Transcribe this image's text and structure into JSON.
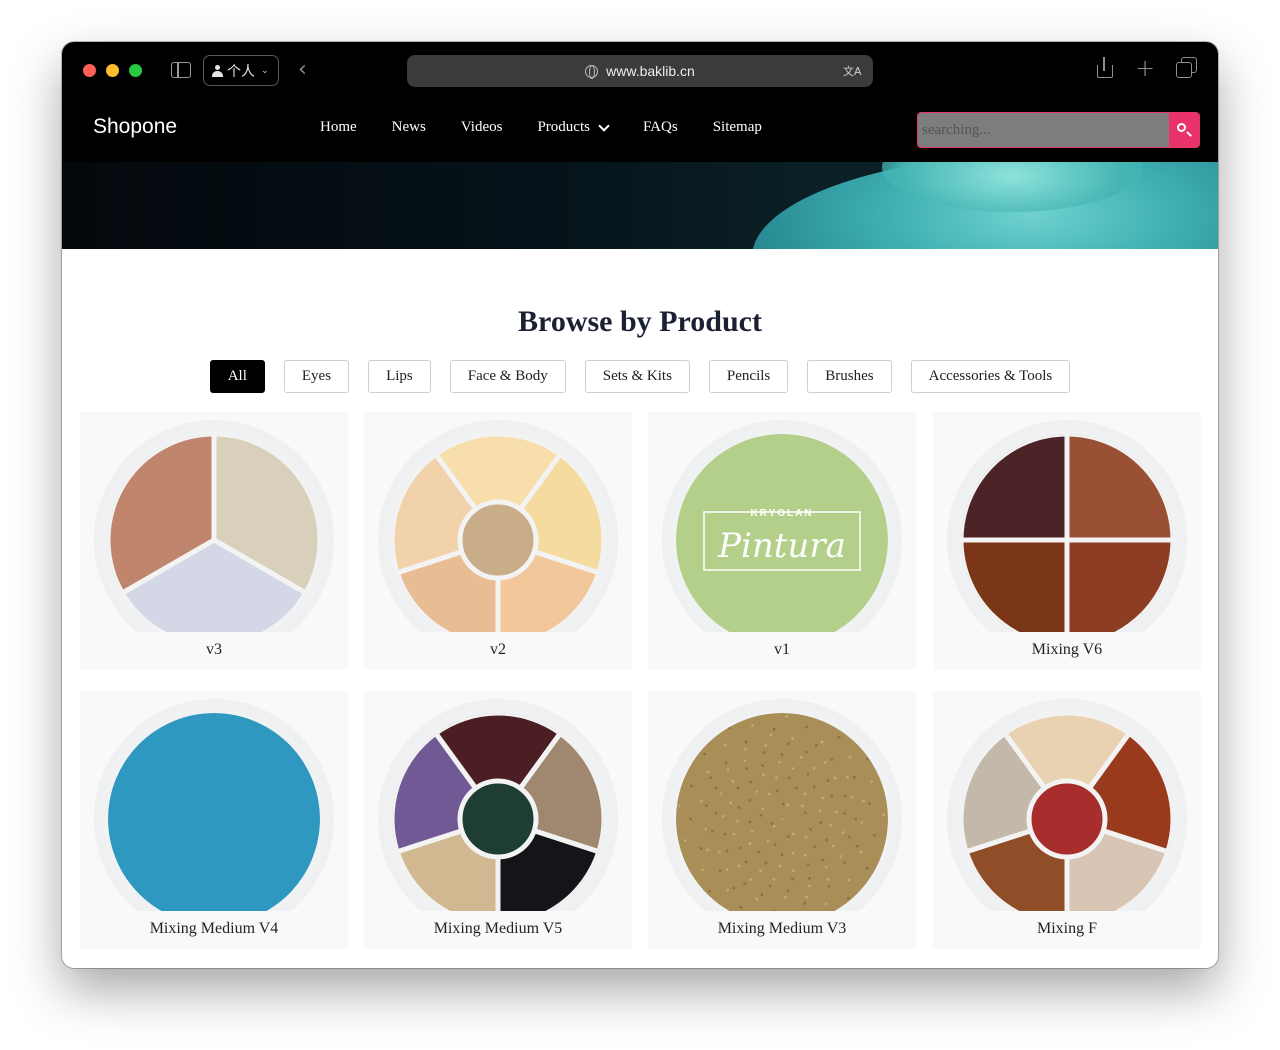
{
  "browser": {
    "profile_label": "个人",
    "url": "www.baklib.cn"
  },
  "site": {
    "logo": "Shopone",
    "nav": [
      "Home",
      "News",
      "Videos",
      "Products",
      "FAQs",
      "Sitemap"
    ],
    "search_placeholder": "searching..."
  },
  "content": {
    "title": "Browse by Product",
    "filters": [
      "All",
      "Eyes",
      "Lips",
      "Face & Body",
      "Sets & Kits",
      "Pencils",
      "Brushes",
      "Accessories & Tools"
    ],
    "active_filter": "All",
    "products": [
      {
        "name": "v3",
        "pattern": "three-segment",
        "colors": [
          "#d9d0bc",
          "#d4d8e6",
          "#c0866d"
        ]
      },
      {
        "name": "v2",
        "pattern": "five-segment-center",
        "colors": [
          "#f7deaa",
          "#f5dba0",
          "#f2c89a",
          "#e8bd93",
          "#f2d2aa"
        ],
        "center": "#c9ad88"
      },
      {
        "name": "v1",
        "pattern": "solid-brand",
        "colors": [
          "#b3cf8a"
        ],
        "brand": "KRYOLAN",
        "brand_script": "Pintura"
      },
      {
        "name": "Mixing V6",
        "pattern": "four-segment",
        "colors": [
          "#4c2326",
          "#9a5035",
          "#8c3d24",
          "#7a3616"
        ]
      },
      {
        "name": "Mixing Medium V4",
        "pattern": "solid",
        "colors": [
          "#2f98c0"
        ]
      },
      {
        "name": "Mixing Medium V5",
        "pattern": "five-segment-center",
        "colors": [
          "#4a1e23",
          "#a08870",
          "#151418",
          "#d1b891",
          "#705995"
        ],
        "center": "#1e3e34"
      },
      {
        "name": "Mixing Medium V3",
        "pattern": "solid-texture",
        "colors": [
          "#a98e58"
        ]
      },
      {
        "name": "Mixing F",
        "pattern": "five-segment-center",
        "colors": [
          "#e8d2b2",
          "#9a3a1c",
          "#d9c5b4",
          "#8f4d28",
          "#c3b8aa"
        ],
        "center": "#a82e2e"
      }
    ]
  },
  "colors": {
    "accent": "#e8336b",
    "nav_bg": "#000000",
    "card_bg": "#f7f9fb",
    "title": "#1b2133"
  }
}
